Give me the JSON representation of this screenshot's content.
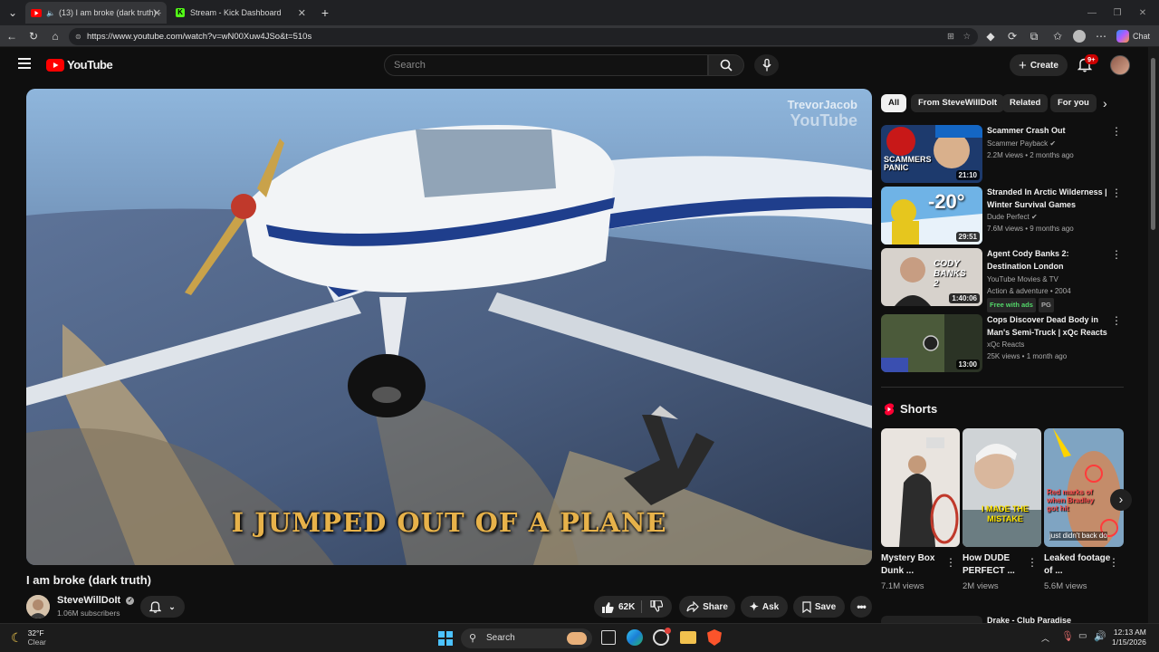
{
  "browser": {
    "tabs": [
      {
        "label": "(13) I am broke (dark truth) -"
      },
      {
        "label": "Stream - Kick Dashboard"
      }
    ],
    "url": "https://www.youtube.com/watch?v=wN00Xuw4JSo&t=510s",
    "chat_label": "Chat"
  },
  "header": {
    "logo_text": "YouTube",
    "search_placeholder": "Search",
    "create_label": "Create",
    "notification_count": "9+"
  },
  "player": {
    "caption": "I JUMPED OUT OF A PLANE",
    "watermark_line1": "TrevorJacob",
    "watermark_line2": "YouTube"
  },
  "video": {
    "title": "I am broke (dark truth)",
    "channel": "SteveWillDoIt",
    "subscribers": "1.06M subscribers",
    "likes": "62K",
    "share_label": "Share",
    "ask_label": "Ask",
    "save_label": "Save"
  },
  "sidebar": {
    "chips": [
      "All",
      "From SteveWillDoIt",
      "Related",
      "For you"
    ],
    "recommendations": [
      {
        "title": "Scammer Crash Out",
        "channel": "Scammer Payback",
        "verified": true,
        "stats": "2.2M views • 2 months ago",
        "duration": "21:10",
        "thumb_text": "SCAMMERS PANIC"
      },
      {
        "title": "Stranded In Arctic Wilderness | Winter Survival Games",
        "channel": "Dude Perfect",
        "verified": true,
        "stats": "7.6M views • 9 months ago",
        "duration": "29:51",
        "thumb_text": "-20°"
      },
      {
        "title": "Agent Cody Banks 2: Destination London",
        "channel": "YouTube Movies & TV",
        "verified": false,
        "stats": "Action & adventure • 2004",
        "duration": "1:40:06",
        "badges": [
          "Free with ads",
          "PG"
        ],
        "thumb_text": "CODY BANKS 2"
      },
      {
        "title": "Cops Discover Dead Body in Man's Semi-Truck | xQc Reacts",
        "channel": "xQc Reacts",
        "verified": false,
        "stats": "25K views • 1 month ago",
        "duration": "13:00"
      }
    ],
    "shorts_heading": "Shorts",
    "shorts": [
      {
        "title": "Mystery Box Dunk ...",
        "views": "7.1M views"
      },
      {
        "title": "How DUDE PERFECT ...",
        "views": "2M views",
        "thumb_text": "I MADE THE MISTAKE"
      },
      {
        "title": "Leaked footage of ...",
        "views": "5.6M views",
        "thumb_text": "Red marks of when Bradley got hit",
        "thumb_text2": "just didn't back do"
      }
    ],
    "next_item_title": "Drake - Club Paradise"
  },
  "taskbar": {
    "weather_temp": "32°F",
    "weather_desc": "Clear",
    "search_label": "Search",
    "time": "12:13 AM",
    "date": "1/15/2026"
  },
  "colors": {
    "yt_red": "#ff0000",
    "background": "#0f0f0f",
    "caption_gold": "#e7b24a"
  }
}
